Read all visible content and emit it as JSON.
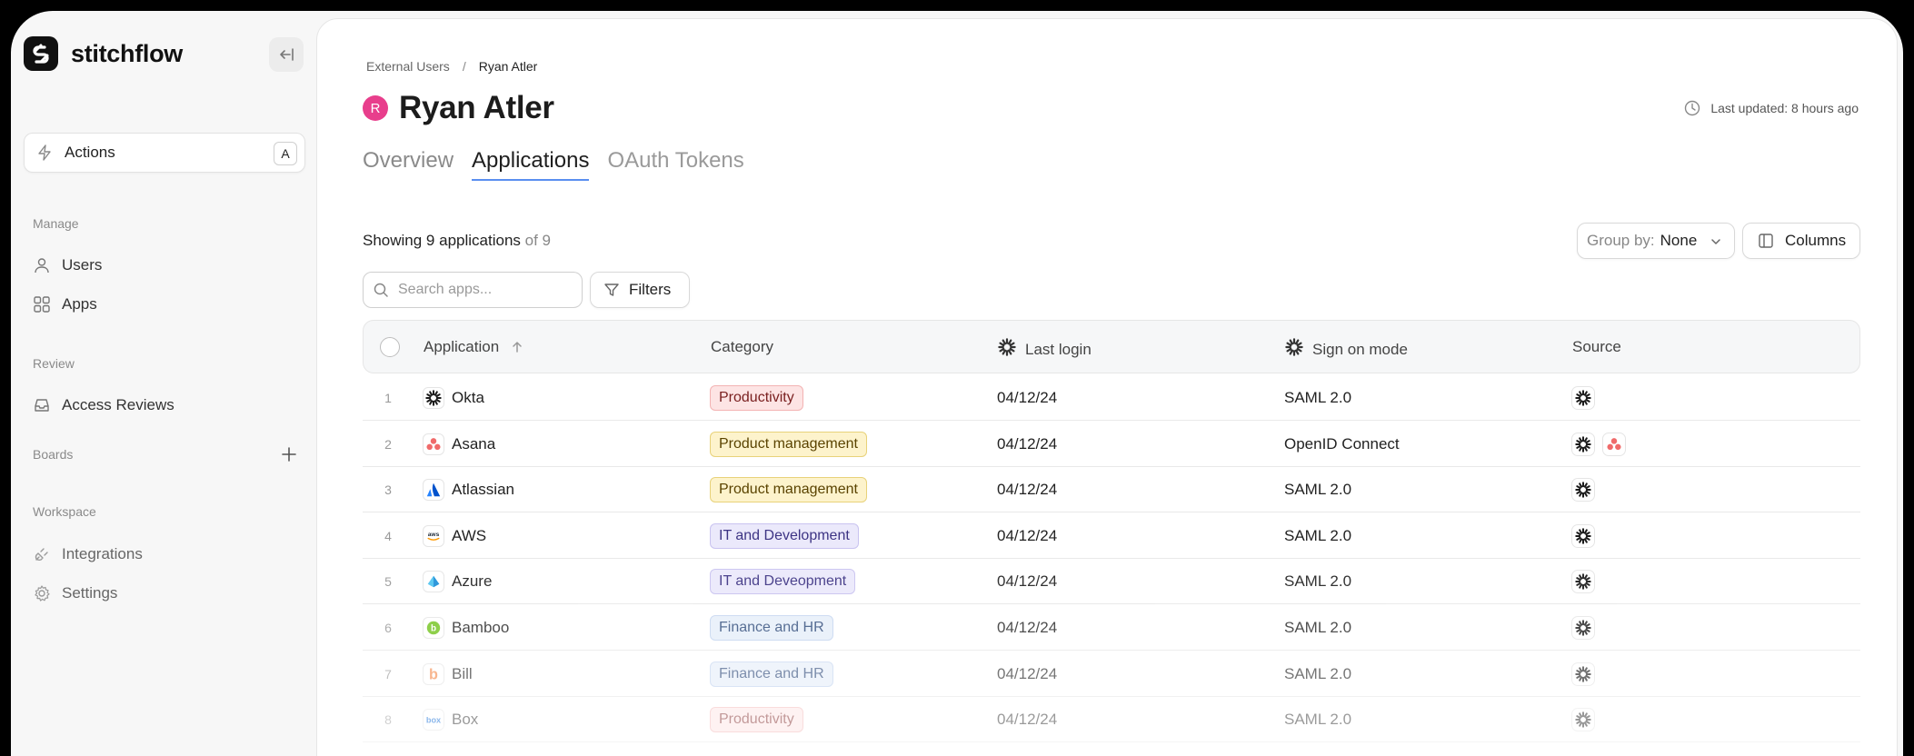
{
  "brand": {
    "name": "stitchflow"
  },
  "sidebar": {
    "actions": {
      "label": "Actions",
      "shortcut": "A"
    },
    "sections": {
      "manage": "Manage",
      "review": "Review",
      "boards": "Boards",
      "workspace": "Workspace"
    },
    "items": {
      "users": "Users",
      "apps": "Apps",
      "access_reviews": "Access Reviews",
      "integrations": "Integrations",
      "settings": "Settings"
    }
  },
  "breadcrumb": {
    "parent": "External Users",
    "separator": "/",
    "current": "Ryan Atler"
  },
  "user": {
    "initial": "R",
    "name": "Ryan Atler",
    "avatar_color": "#e83e8c"
  },
  "last_updated": "Last updated: 8 hours ago",
  "tabs": [
    "Overview",
    "Applications",
    "OAuth Tokens"
  ],
  "active_tab": "Applications",
  "summary": {
    "showing": "Showing 9 applications",
    "of": "of 9"
  },
  "toolbar": {
    "group_by_label": "Group by:",
    "group_by_value": "None",
    "columns_label": "Columns",
    "search_placeholder": "Search apps...",
    "filters_label": "Filters"
  },
  "table": {
    "columns": [
      "Application",
      "Category",
      "Last login",
      "Sign on mode",
      "Source"
    ],
    "rows": [
      {
        "num": "1",
        "app": "Okta",
        "icon": "okta-icon",
        "category": "Productivity",
        "cat_style": "red",
        "last_login": "04/12/24",
        "sign_on": "SAML 2.0",
        "sources": [
          "okta-icon"
        ]
      },
      {
        "num": "2",
        "app": "Asana",
        "icon": "asana-icon",
        "category": "Product management",
        "cat_style": "yellow",
        "last_login": "04/12/24",
        "sign_on": "OpenID Connect",
        "sources": [
          "okta-icon",
          "asana-icon"
        ]
      },
      {
        "num": "3",
        "app": "Atlassian",
        "icon": "atlassian-icon",
        "category": "Product management",
        "cat_style": "yellow",
        "last_login": "04/12/24",
        "sign_on": "SAML 2.0",
        "sources": [
          "okta-icon"
        ]
      },
      {
        "num": "4",
        "app": "AWS",
        "icon": "aws-icon",
        "category": "IT and Development",
        "cat_style": "purple",
        "last_login": "04/12/24",
        "sign_on": "SAML 2.0",
        "sources": [
          "okta-icon"
        ]
      },
      {
        "num": "5",
        "app": "Azure",
        "icon": "azure-icon",
        "category": "IT and Deveopment",
        "cat_style": "purple",
        "last_login": "04/12/24",
        "sign_on": "SAML 2.0",
        "sources": [
          "okta-icon"
        ]
      },
      {
        "num": "6",
        "app": "Bamboo",
        "icon": "bamboo-icon",
        "category": "Finance and HR",
        "cat_style": "blue",
        "last_login": "04/12/24",
        "sign_on": "SAML 2.0",
        "sources": [
          "okta-icon"
        ]
      },
      {
        "num": "7",
        "app": "Bill",
        "icon": "bill-icon",
        "category": "Finance and HR",
        "cat_style": "blue",
        "last_login": "04/12/24",
        "sign_on": "SAML 2.0",
        "sources": [
          "okta-icon"
        ]
      },
      {
        "num": "8",
        "app": "Box",
        "icon": "box-icon",
        "category": "Productivity",
        "cat_style": "red",
        "last_login": "04/12/24",
        "sign_on": "SAML 2.0",
        "sources": [
          "okta-icon"
        ]
      }
    ]
  },
  "colors": {
    "accent": "#5a8ff0",
    "badge_red_bg": "#fde4e4",
    "badge_red_border": "#f3b3b3",
    "badge_red_text": "#7a2020",
    "badge_yellow_bg": "#fdf3cc",
    "badge_yellow_border": "#e8d27a",
    "badge_yellow_text": "#5a4300",
    "badge_purple_bg": "#ebe9fb",
    "badge_purple_border": "#c9c3f0",
    "badge_purple_text": "#3d3484",
    "badge_blue_bg": "#e6eefa",
    "badge_blue_border": "#c3d4ef",
    "badge_blue_text": "#2e4a7a"
  }
}
